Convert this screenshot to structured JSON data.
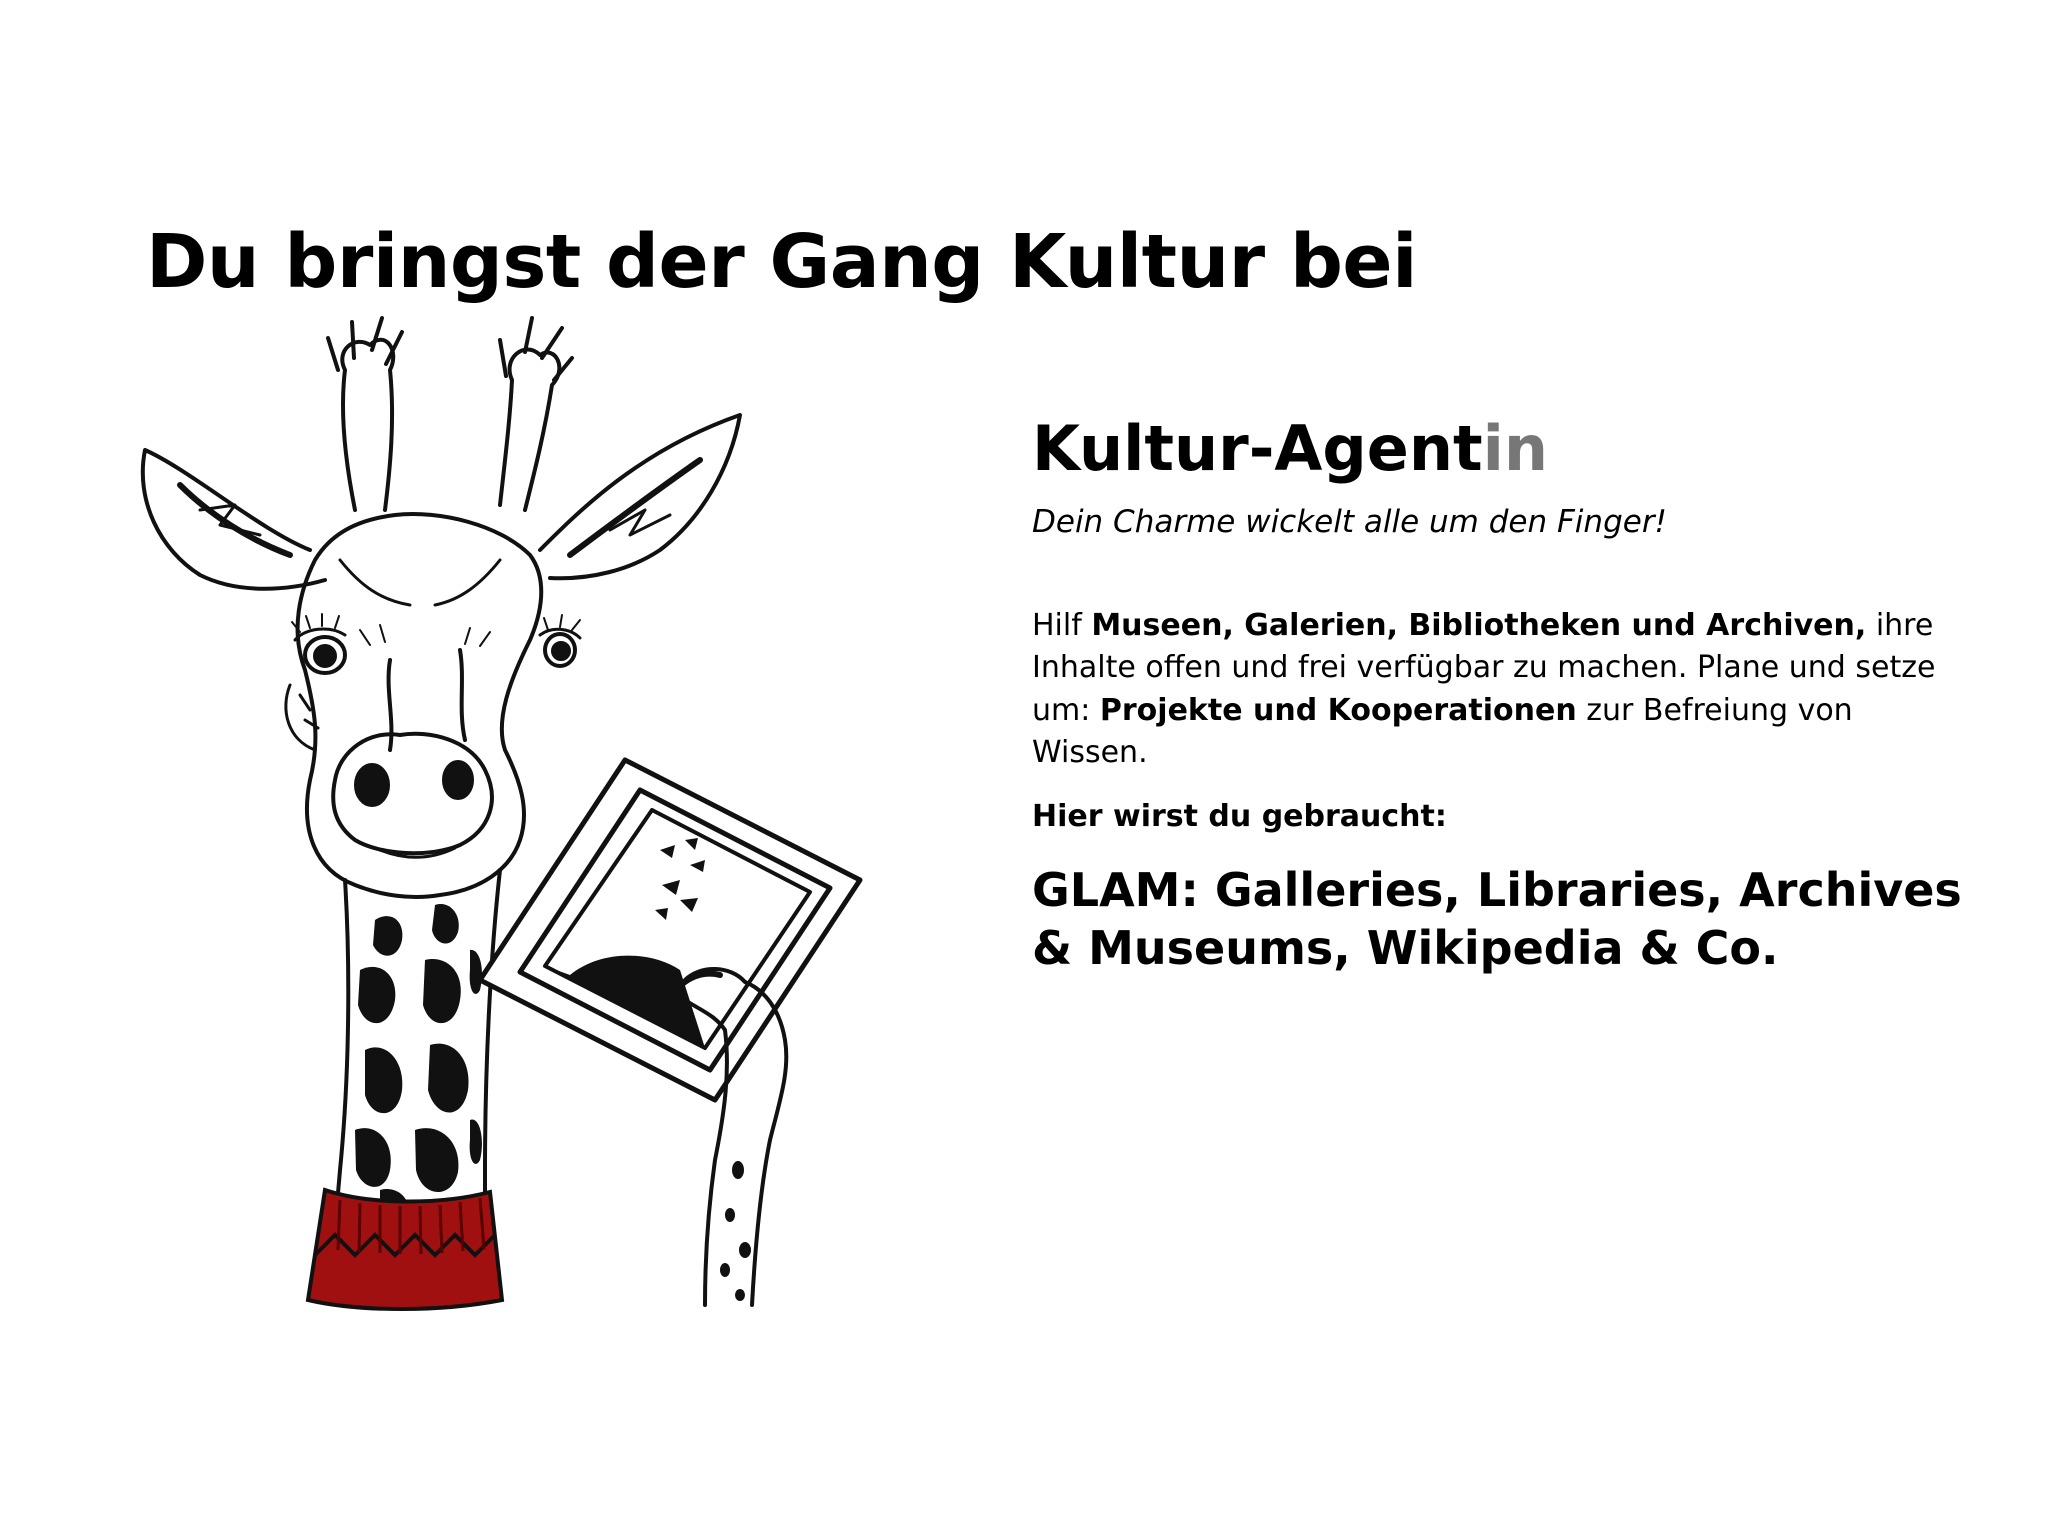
{
  "headline": "Du bringst der Gang Kultur bei",
  "illustration": {
    "subject": "giraffe-with-picture-frame",
    "accent_color": "#a01010"
  },
  "role": {
    "title_main": "Kultur-Agent",
    "title_suffix": "in",
    "suffix_color": "#777777",
    "tagline": "Dein Charme wickelt alle um den Finger!"
  },
  "description": {
    "part1": "Hilf ",
    "bold1": "Museen, Galerien, Bibliotheken und Archiven,",
    "part2": " ihre Inhalte offen und frei verfügbar zu machen. Plane und setze um: ",
    "bold2": "Projekte und Kooperationen",
    "part3": " zur Befreiung von Wissen."
  },
  "needed_label": "Hier wirst du gebraucht:",
  "fields": "GLAM: Galleries, Libraries, Archives & Museums, Wikipedia & Co."
}
